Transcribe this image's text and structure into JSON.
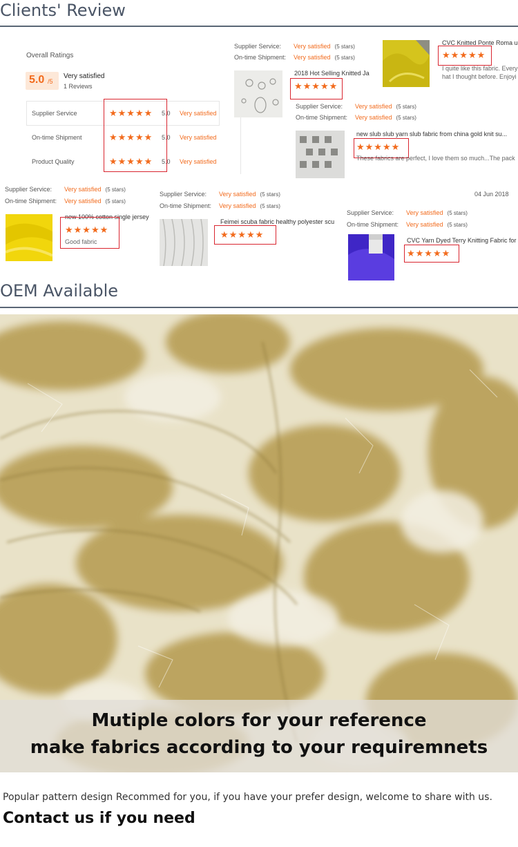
{
  "clients_review": {
    "title": "Clients' Review"
  },
  "overall": {
    "label": "Overall Ratings",
    "score": "5.0",
    "score_suffix": "/5",
    "verdict": "Very satisfied",
    "reviews": "1 Reviews",
    "rows": [
      {
        "label": "Supplier Service",
        "stars": "★★★★★",
        "score": "5.0",
        "text": "Very satisfied"
      },
      {
        "label": "On-time Shipment",
        "stars": "★★★★★",
        "score": "5.0",
        "text": "Very satisfied"
      },
      {
        "label": "Product Quality",
        "stars": "★★★★★",
        "score": "5.0",
        "text": "Very satisfied"
      }
    ]
  },
  "common": {
    "supplier_service": "Supplier Service:",
    "ontime_shipment": "On-time Shipment:",
    "very_satisfied": "Very satisfied",
    "five_stars": "(5 stars)",
    "stars": "★★★★★"
  },
  "reviews": {
    "r1": {
      "title": "2018 Hot Selling Knitted Ja"
    },
    "r2": {
      "title": "CVC Knitted Ponte Roma u",
      "comment": "I quite like this fabric. Every",
      "comment2": "hat I thought before. Enjoyi"
    },
    "r3": {
      "title": "new slub slub yarn slub fabric from china gold knit su...",
      "comment": "These fabrics are perfect, I love them so much...The pack"
    },
    "r4": {
      "title": "new 100% cotton single jersey",
      "comment": "Good fabric"
    },
    "r5": {
      "title": "Feimei scuba fabric healthy polyester scu",
      "date": "04 Jun 2018"
    },
    "r6": {
      "title": "CVC Yarn Dyed Terry Knitting Fabric for"
    }
  },
  "oem": {
    "title": "OEM Available"
  },
  "hero": {
    "line1": "Mutiple colors for your reference",
    "line2": "make fabrics according to your requiremnets"
  },
  "footer": {
    "note": "Popular pattern design Recommed for you, if you have your prefer design, welcome to share with us.",
    "contact": "Contact us if you need"
  }
}
